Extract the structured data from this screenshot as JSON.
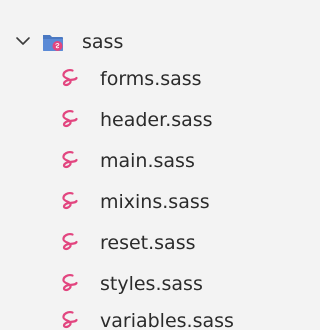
{
  "folder": {
    "name": "sass",
    "icon": "sass-folder-icon",
    "expanded": true,
    "chevron_icon": "chevron-down-icon",
    "folder_color": "#4a78c2",
    "badge_color": "#e2457f"
  },
  "files": [
    {
      "name": "forms.sass",
      "icon": "sass-icon"
    },
    {
      "name": "header.sass",
      "icon": "sass-icon"
    },
    {
      "name": "main.sass",
      "icon": "sass-icon"
    },
    {
      "name": "mixins.sass",
      "icon": "sass-icon"
    },
    {
      "name": "reset.sass",
      "icon": "sass-icon"
    },
    {
      "name": "styles.sass",
      "icon": "sass-icon"
    },
    {
      "name": "variables.sass",
      "icon": "sass-icon"
    }
  ],
  "colors": {
    "background": "#f3f3f3",
    "text": "#2b2b2b",
    "sass_icon": "#e2457f"
  }
}
